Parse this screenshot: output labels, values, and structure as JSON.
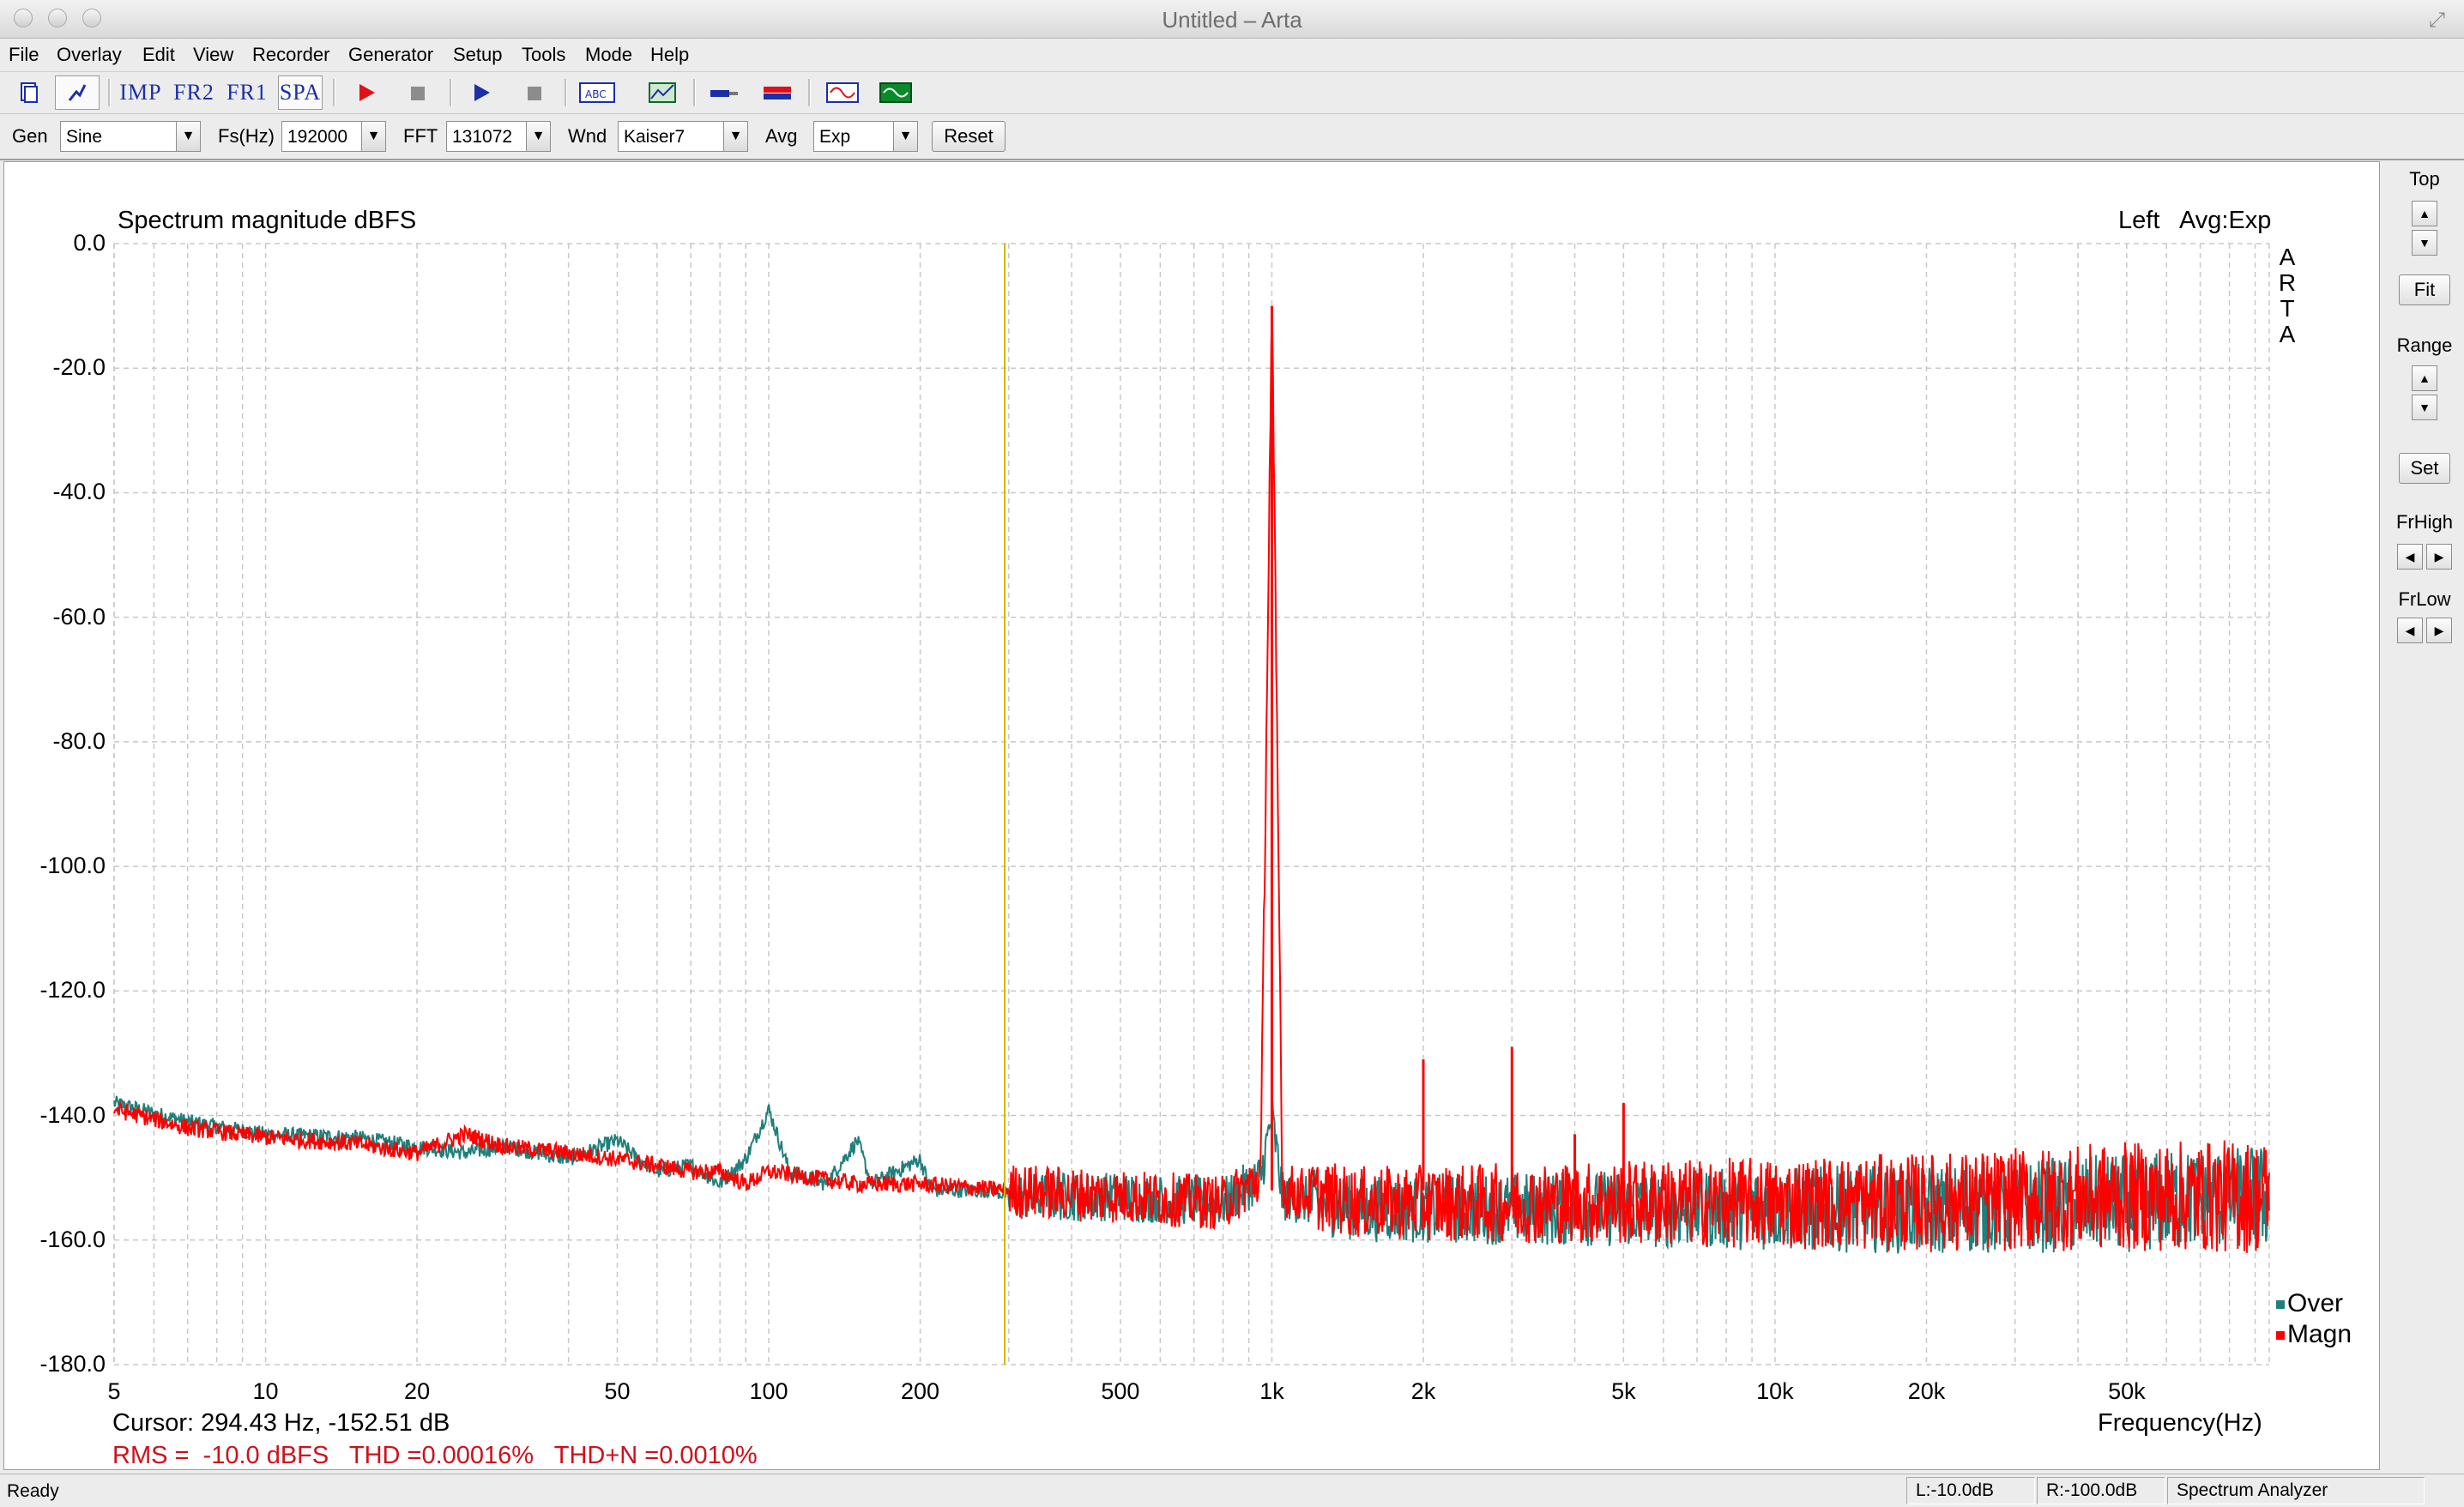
{
  "window": {
    "title": "Untitled – Arta"
  },
  "menu": [
    "File",
    "Overlay",
    "Edit",
    "View",
    "Recorder",
    "Generator",
    "Setup",
    "Tools",
    "Mode",
    "Help"
  ],
  "toolbar": {
    "imp_label": "IMP",
    "fr2_label": "FR2",
    "fr1_label": "FR1",
    "spa_label": "SPA",
    "active_mode": "SPA",
    "accent_red": "#e0101a",
    "accent_blue": "#1b2fa8"
  },
  "controls": {
    "gen_label": "Gen",
    "gen_value": "Sine",
    "fs_label": "Fs(Hz)",
    "fs_value": "192000",
    "fft_label": "FFT",
    "fft_value": "131072",
    "wnd_label": "Wnd",
    "wnd_value": "Kaiser7",
    "avg_label": "Avg",
    "avg_value": "Exp",
    "reset_label": "Reset"
  },
  "plot": {
    "title": "Spectrum magnitude dBFS",
    "channel_info": "Left   Avg:Exp",
    "arta_letters": [
      "A",
      "R",
      "T",
      "A"
    ],
    "cursor_text": "Cursor: 294.43 Hz, -152.51 dB",
    "stats_text": "RMS =  -10.0 dBFS   THD =0.00016%   THD+N =0.0010%",
    "legend": [
      {
        "label": "Over",
        "color": "#1f7f7a"
      },
      {
        "label": "Magn",
        "color": "#ff0000"
      }
    ]
  },
  "chart_data": {
    "type": "line",
    "title": "Spectrum magnitude dBFS",
    "xlabel": "Frequency(Hz)",
    "ylabel": "",
    "x_scale": "log",
    "xlim": [
      5,
      96000
    ],
    "ylim": [
      -180,
      0
    ],
    "x_ticks": [
      5,
      10,
      20,
      50,
      100,
      200,
      500,
      1000,
      2000,
      5000,
      10000,
      20000,
      50000
    ],
    "x_tick_labels": [
      "5",
      "10",
      "20",
      "50",
      "100",
      "200",
      "500",
      "1k",
      "2k",
      "5k",
      "10k",
      "20k",
      "50k"
    ],
    "y_ticks": [
      0,
      -20,
      -40,
      -60,
      -80,
      -100,
      -120,
      -140,
      -160,
      -180
    ],
    "y_tick_labels": [
      "0.0",
      "-20.0",
      "-40.0",
      "-60.0",
      "-80.0",
      "-100.0",
      "-120.0",
      "-140.0",
      "-160.0",
      "-180.0"
    ],
    "grid": true,
    "legend_position": "bottom-right",
    "cursor_marker_hz": 294.43,
    "series": [
      {
        "name": "Over",
        "color": "#1f7f7a",
        "points": [
          [
            5,
            -138
          ],
          [
            7,
            -141
          ],
          [
            10,
            -143
          ],
          [
            15,
            -143.5
          ],
          [
            20,
            -145
          ],
          [
            25,
            -146
          ],
          [
            30,
            -145
          ],
          [
            40,
            -147
          ],
          [
            50,
            -144
          ],
          [
            55,
            -147
          ],
          [
            60,
            -149
          ],
          [
            70,
            -148
          ],
          [
            80,
            -151
          ],
          [
            90,
            -147
          ],
          [
            100,
            -139
          ],
          [
            110,
            -149
          ],
          [
            130,
            -151
          ],
          [
            150,
            -144
          ],
          [
            160,
            -151
          ],
          [
            200,
            -147
          ],
          [
            210,
            -152
          ],
          [
            280,
            -152
          ],
          [
            300,
            -153
          ],
          [
            500,
            -153
          ],
          [
            800,
            -154
          ],
          [
            950,
            -150
          ],
          [
            1000,
            -140
          ],
          [
            1050,
            -153
          ],
          [
            1500,
            -155
          ],
          [
            2000,
            -155
          ],
          [
            5000,
            -155
          ],
          [
            10000,
            -155
          ],
          [
            20000,
            -155
          ],
          [
            50000,
            -154
          ],
          [
            96000,
            -153
          ]
        ]
      },
      {
        "name": "Magn",
        "color": "#ff0000",
        "points": [
          [
            5,
            -139
          ],
          [
            7,
            -142
          ],
          [
            10,
            -143.5
          ],
          [
            15,
            -144.5
          ],
          [
            20,
            -146
          ],
          [
            25,
            -143
          ],
          [
            30,
            -145
          ],
          [
            40,
            -146
          ],
          [
            50,
            -147
          ],
          [
            60,
            -148
          ],
          [
            70,
            -149
          ],
          [
            80,
            -149
          ],
          [
            90,
            -151
          ],
          [
            100,
            -149
          ],
          [
            150,
            -151
          ],
          [
            200,
            -151
          ],
          [
            300,
            -152
          ],
          [
            500,
            -153
          ],
          [
            800,
            -154
          ],
          [
            950,
            -150
          ],
          [
            1000,
            -10
          ],
          [
            1050,
            -152
          ],
          [
            1500,
            -154
          ],
          [
            2000,
            -154
          ],
          [
            5000,
            -154
          ],
          [
            10000,
            -154
          ],
          [
            20000,
            -154
          ],
          [
            50000,
            -153
          ],
          [
            96000,
            -153
          ]
        ],
        "peaks": [
          {
            "hz": 1000,
            "db": -10
          },
          {
            "hz": 2000,
            "db": -131
          },
          {
            "hz": 3000,
            "db": -129
          },
          {
            "hz": 4000,
            "db": -143
          },
          {
            "hz": 5000,
            "db": -138
          },
          {
            "hz": 6000,
            "db": -148
          }
        ]
      }
    ]
  },
  "right_panel": {
    "top_label": "Top",
    "fit_label": "Fit",
    "range_label": "Range",
    "set_label": "Set",
    "frhigh_label": "FrHigh",
    "frlow_label": "FrLow"
  },
  "status": {
    "ready": "Ready",
    "left_level": "L:-10.0dB",
    "right_level": "R:-100.0dB",
    "mode": "Spectrum Analyzer"
  }
}
